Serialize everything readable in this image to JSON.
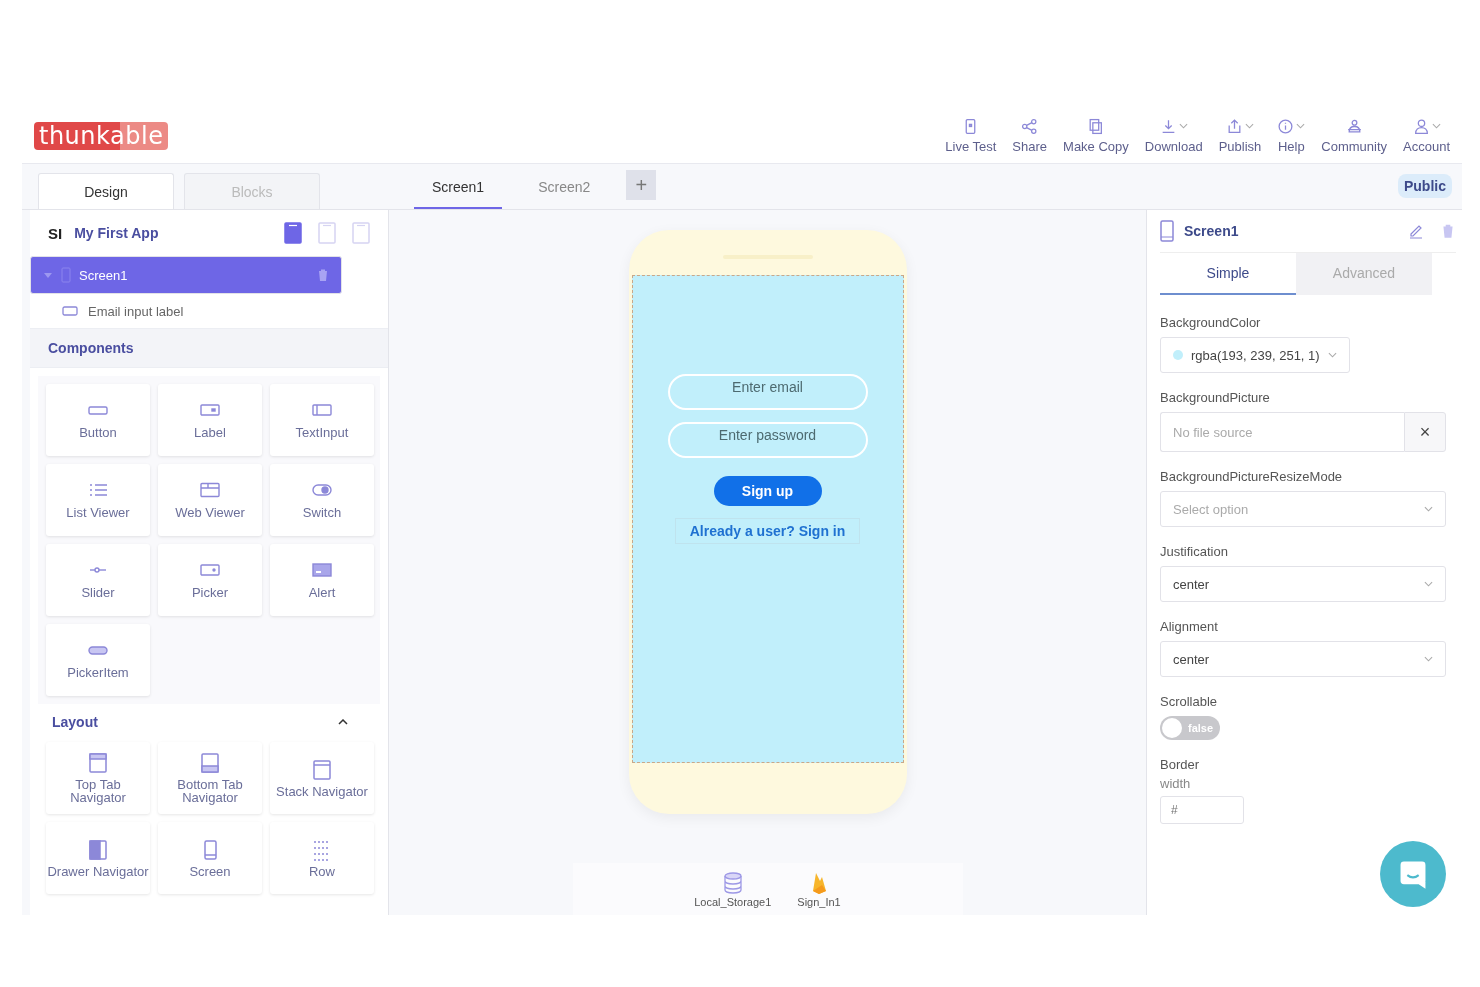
{
  "logo": {
    "text": "thunkable"
  },
  "toolbar": [
    {
      "label": "Live Test",
      "dropdown": false
    },
    {
      "label": "Share",
      "dropdown": false
    },
    {
      "label": "Make Copy",
      "dropdown": false
    },
    {
      "label": "Download",
      "dropdown": true
    },
    {
      "label": "Publish",
      "dropdown": true
    },
    {
      "label": "Help",
      "dropdown": true
    },
    {
      "label": "Community",
      "dropdown": false
    },
    {
      "label": "Account",
      "dropdown": true
    }
  ],
  "mode_tabs": [
    {
      "label": "Design",
      "selected": true
    },
    {
      "label": "Blocks",
      "selected": false
    }
  ],
  "screen_tabs": [
    {
      "label": "Screen1",
      "selected": true
    },
    {
      "label": "Screen2",
      "selected": false
    }
  ],
  "add_screen": "+",
  "visibility_badge": "Public",
  "project": {
    "initials": "SI",
    "name": "My First App",
    "devices": [
      {
        "selected": true
      },
      {
        "selected": false
      },
      {
        "selected": false
      }
    ]
  },
  "tree": [
    {
      "label": "Screen1",
      "selected": true,
      "expanded": true,
      "children": [
        {
          "label": "Email input label",
          "selected": false
        }
      ]
    }
  ],
  "components": {
    "title": "Components",
    "items": [
      "Button",
      "Label",
      "TextInput",
      "List Viewer",
      "Web Viewer",
      "Switch",
      "Slider",
      "Picker",
      "Alert",
      "PickerItem"
    ]
  },
  "layout": {
    "title": "Layout",
    "expanded": true,
    "items": [
      "Top Tab Navigator",
      "Bottom Tab Navigator",
      "Stack Navigator",
      "Drawer Navigator",
      "Screen",
      "Row"
    ]
  },
  "phone": {
    "inputs": [
      {
        "placeholder": "Enter email"
      },
      {
        "placeholder": "Enter password"
      }
    ],
    "button": "Sign up",
    "link": "Already a user? Sign in"
  },
  "invisible_components": [
    {
      "label": "Local_Storage1",
      "kind": "database"
    },
    {
      "label": "Sign_In1",
      "kind": "flame"
    }
  ],
  "properties_panel": {
    "title": "Screen1",
    "tabs": [
      {
        "label": "Simple",
        "selected": true
      },
      {
        "label": "Advanced",
        "selected": false
      }
    ],
    "fields": [
      {
        "kind": "color",
        "label": "BackgroundColor",
        "value": "rgba(193, 239, 251, 1)",
        "color": "#c1effb"
      },
      {
        "kind": "file",
        "label": "BackgroundPicture",
        "placeholder": "No file source",
        "clear": "×"
      },
      {
        "kind": "select",
        "label": "BackgroundPictureResizeMode",
        "placeholder": "Select option"
      },
      {
        "kind": "select",
        "label": "Justification",
        "value": "center"
      },
      {
        "kind": "select",
        "label": "Alignment",
        "value": "center"
      },
      {
        "kind": "toggle",
        "label": "Scrollable",
        "on": false,
        "value": "false"
      },
      {
        "kind": "number",
        "label": "Border",
        "sublabel": "width",
        "placeholder": "#"
      }
    ]
  }
}
